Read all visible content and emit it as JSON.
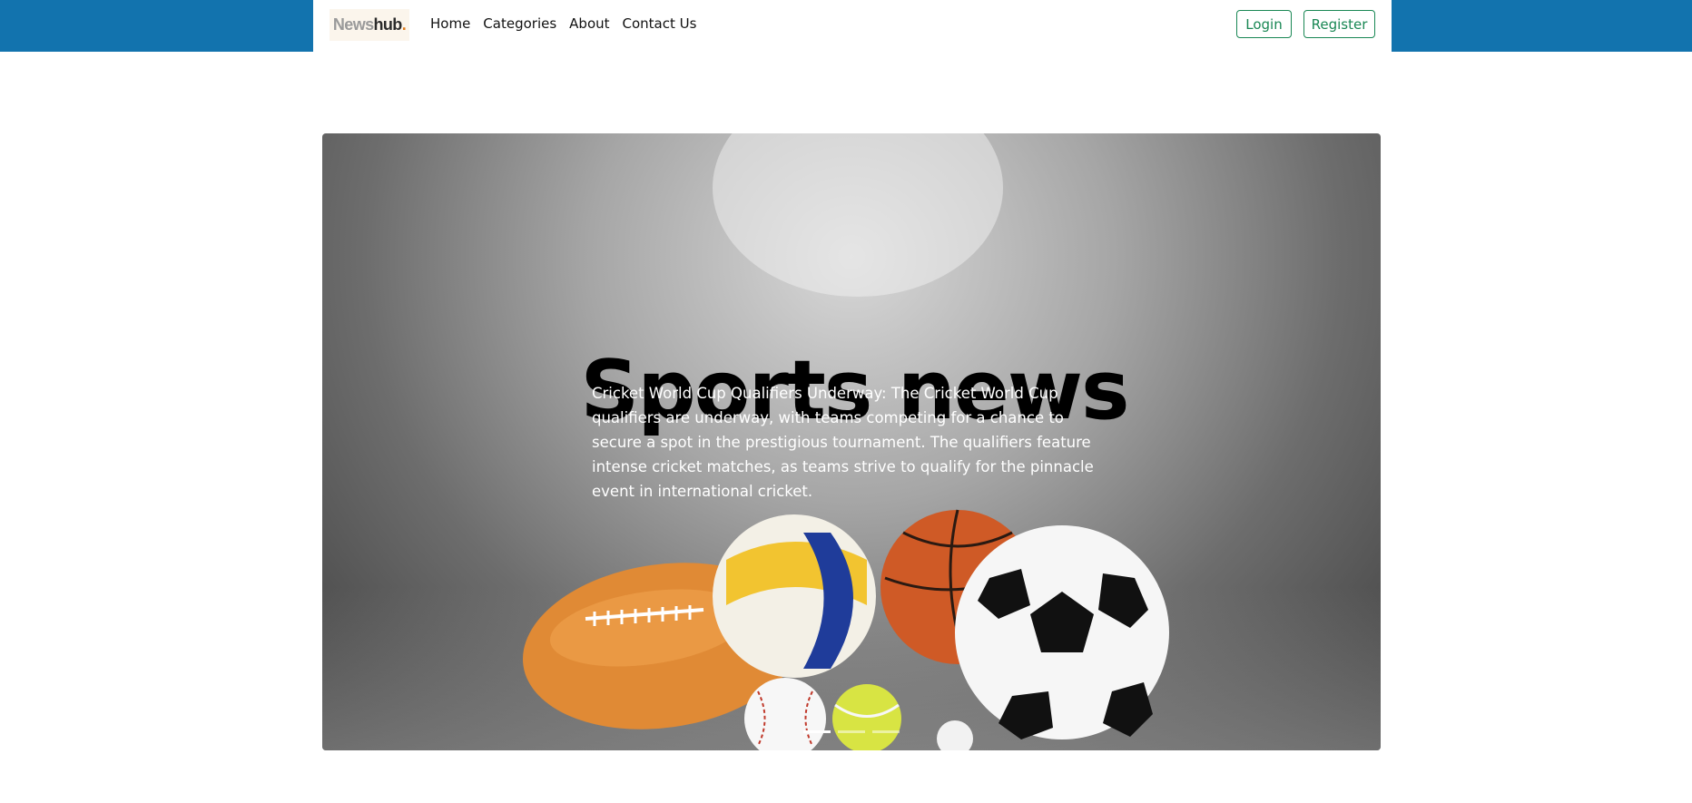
{
  "brand": {
    "part1": "News",
    "part2": "hub",
    "part3": "."
  },
  "nav": {
    "items": [
      {
        "label": "Home"
      },
      {
        "label": "Categories"
      },
      {
        "label": "About"
      },
      {
        "label": "Contact Us"
      }
    ]
  },
  "auth": {
    "login_label": "Login",
    "register_label": "Register"
  },
  "carousel": {
    "slide_title": "Sports news",
    "slide_caption": "Cricket World Cup Qualifiers Underway: The Cricket World Cup qualifiers are underway, with teams competing for a chance to secure a spot in the prestigious tournament. The qualifiers feature intense cricket matches, as teams strive to qualify for the pinnacle event in international cricket.",
    "indicator_count": 3,
    "active_indicator": 1
  },
  "colors": {
    "header_bar": "#1273ae",
    "button_outline": "#198754"
  }
}
